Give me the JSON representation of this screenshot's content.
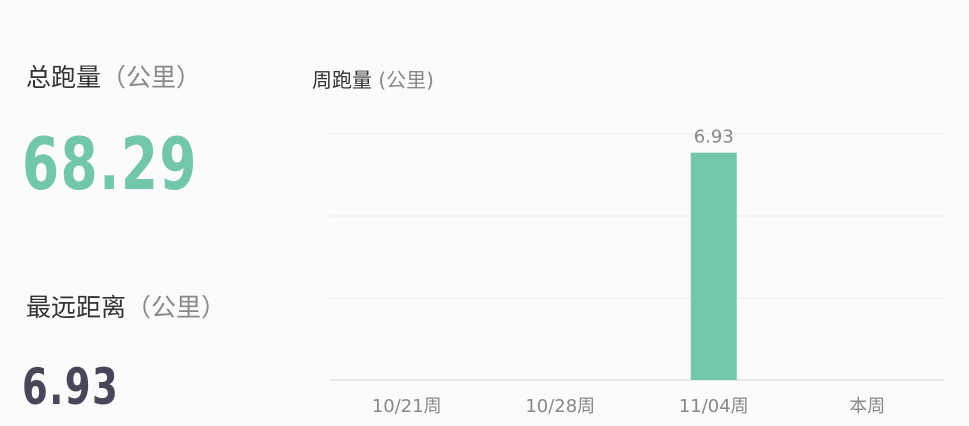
{
  "summary": {
    "total": {
      "label": "总跑量",
      "unit": "（公里）",
      "value": "68.29"
    },
    "farthest": {
      "label": "最远距离",
      "unit": "（公里）",
      "value": "6.93"
    }
  },
  "colors": {
    "accent": "#72c7ab",
    "dark_value": "#4a4558",
    "grid": "#ebebeb"
  },
  "chart_title": {
    "label": "周跑量",
    "unit": "(公里)"
  },
  "chart_data": {
    "type": "bar",
    "title": "周跑量 (公里)",
    "categories": [
      "10/21周",
      "10/28周",
      "11/04周",
      "本周"
    ],
    "values": [
      0,
      0,
      6.93,
      0
    ],
    "data_labels": [
      "",
      "",
      "6.93",
      ""
    ],
    "ylim": [
      0,
      7.5
    ],
    "grid": true,
    "xlabel": "",
    "ylabel": ""
  }
}
